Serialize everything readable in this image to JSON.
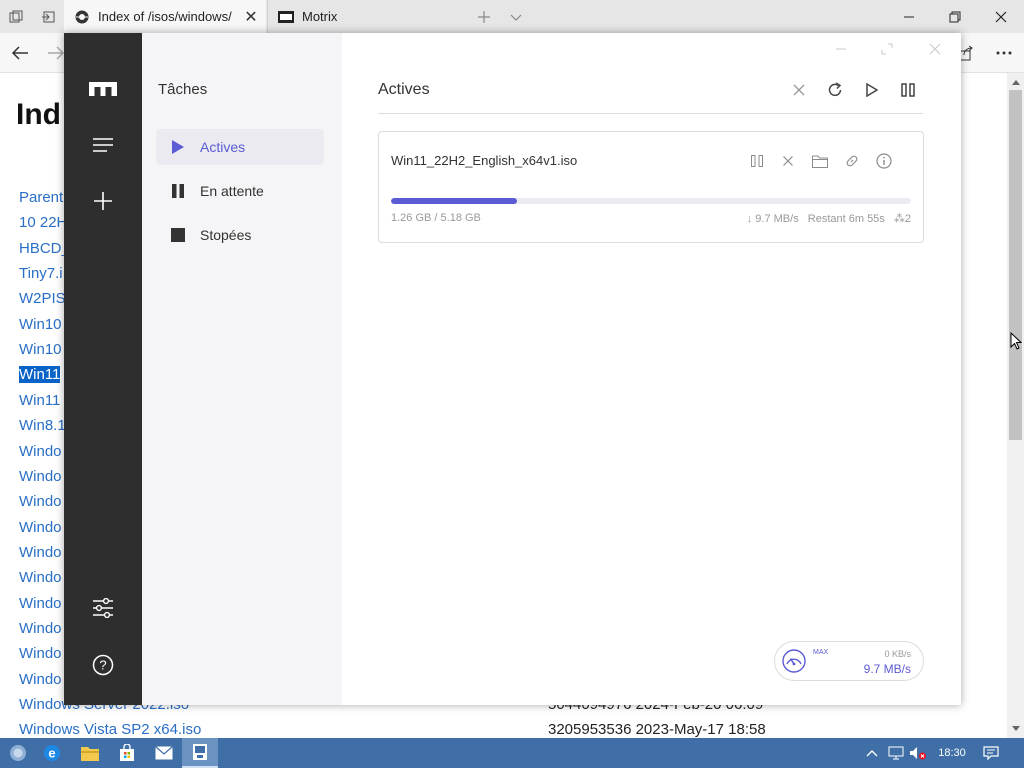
{
  "browser": {
    "tabs": [
      {
        "title": "Index of /isos/windows/",
        "active": true
      },
      {
        "title": "Motrix",
        "active": false
      }
    ],
    "page": {
      "heading": "Ind",
      "links": [
        "Parent",
        "10 22H",
        "HBCD_",
        "Tiny7.i",
        "W2PIS",
        "Win10",
        "Win10",
        "Win11",
        "Win11",
        "Win8.1",
        "Windo",
        "Windo",
        "Windo",
        "Windo",
        "Windo",
        "Windo",
        "Windo",
        "Windo",
        "Windo",
        "Windo",
        "Windows Server 2022.iso",
        "Windows Vista SP2 x64.iso"
      ],
      "selected_link_index": 7,
      "meta_rows": [
        "5044094976 2024-Feb-20 06:09",
        "3205953536 2023-May-17 18:58"
      ]
    }
  },
  "motrix": {
    "sidebar": {
      "title": "Tâches",
      "items": [
        {
          "label": "Actives",
          "icon": "play-icon",
          "active": true
        },
        {
          "label": "En attente",
          "icon": "pause-icon",
          "active": false
        },
        {
          "label": "Stopées",
          "icon": "stop-icon",
          "active": false
        }
      ]
    },
    "main": {
      "title": "Actives",
      "task": {
        "name": "Win11_22H2_English_x64v1.iso",
        "size": "1.26 GB / 5.18 GB",
        "progress": 0.243,
        "speed": "↓ 9.7 MB/s",
        "remaining": "Restant 6m 55s",
        "connections": "⁂2"
      }
    },
    "speed": {
      "max_label": "MAX",
      "limit": "0 KB/s",
      "current": "9.7 MB/s"
    }
  },
  "taskbar": {
    "clock": "18:30"
  },
  "colors": {
    "accent": "#5b5bd6",
    "rail": "#2e2e2e",
    "taskbar": "#3f6fa6",
    "link": "#2a6fc7"
  }
}
